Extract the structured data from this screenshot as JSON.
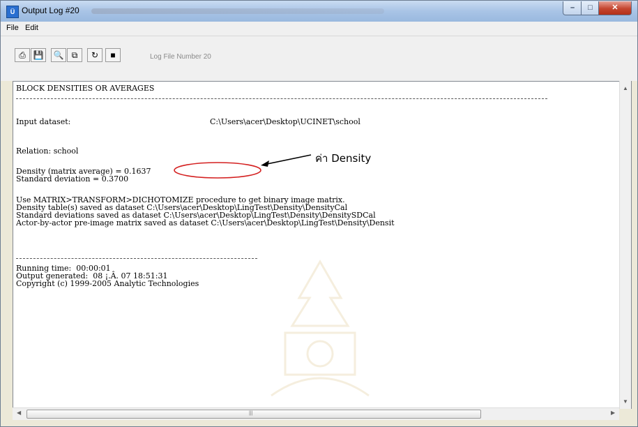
{
  "window": {
    "title": "Output Log #20"
  },
  "menu": {
    "file": "File",
    "edit": "Edit"
  },
  "toolbar": {
    "log_label": "Log File Number 20",
    "buttons": [
      {
        "name": "print-icon",
        "glyph": "⎙"
      },
      {
        "name": "save-icon",
        "glyph": "💾"
      },
      {
        "name": "find-icon",
        "glyph": "🔍"
      },
      {
        "name": "copy-icon",
        "glyph": "⧉"
      },
      {
        "name": "refresh-icon",
        "glyph": "↻"
      },
      {
        "name": "stop-icon",
        "glyph": "■"
      }
    ]
  },
  "log": {
    "header": "BLOCK DENSITIES OR AVERAGES",
    "input_label": "Input dataset:",
    "input_value": "C:\\Users\\acer\\Desktop\\UCINET\\school",
    "relation": "Relation: school",
    "density": "Density (matrix average) = 0.1637",
    "stddev": "Standard deviation = 0.3700",
    "note1": "Use MATRIX>TRANSFORM>DICHOTOMIZE procedure to get binary image matrix.",
    "note2": "Density table(s) saved as dataset C:\\Users\\acer\\Desktop\\LingTest\\Density\\DensityCal",
    "note3": "Standard deviations saved as dataset C:\\Users\\acer\\Desktop\\LingTest\\Density\\DensitySDCal",
    "note4": "Actor-by-actor pre-image matrix saved as dataset C:\\Users\\acer\\Desktop\\LingTest\\Density\\Densit",
    "running": "Running time:  00:00:01",
    "generated": "Output generated:  08 ¡.Â. 07 18:51:31",
    "copyright": "Copyright (c) 1999-2005 Analytic Technologies"
  },
  "annotation": {
    "label": "ค่า Density",
    "color": "#d42020"
  },
  "scrollbar": {
    "grip": "|||"
  }
}
